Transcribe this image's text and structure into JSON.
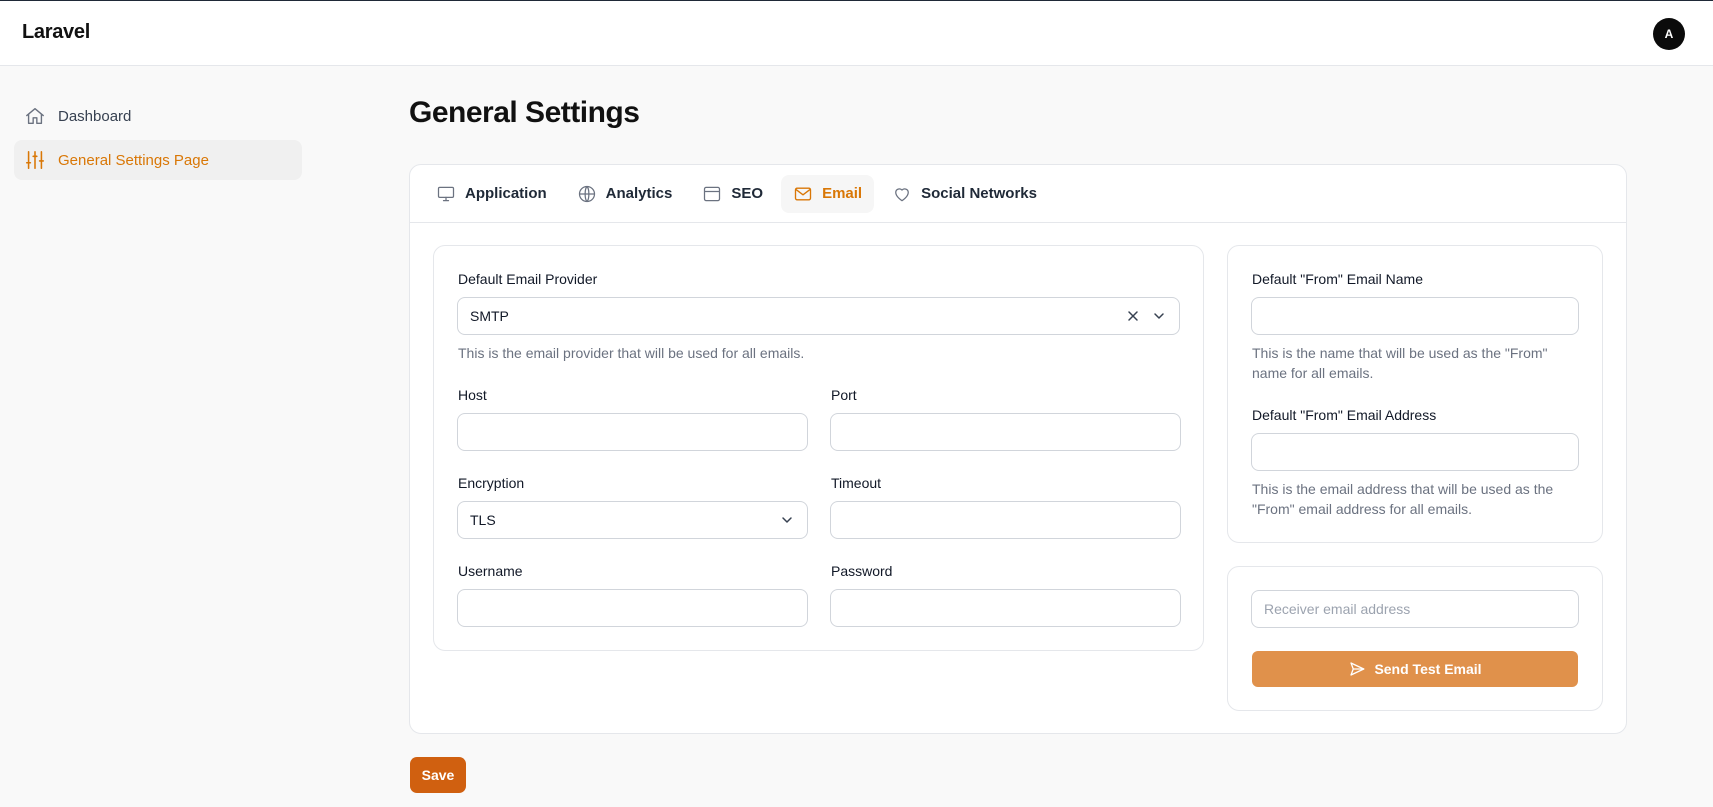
{
  "app": {
    "brand": "Laravel",
    "avatar_initial": "A"
  },
  "sidebar": {
    "items": [
      {
        "label": "Dashboard",
        "icon": "home-icon",
        "active": false
      },
      {
        "label": "General Settings Page",
        "icon": "sliders-icon",
        "active": true
      }
    ]
  },
  "page": {
    "title": "General Settings"
  },
  "tabs": [
    {
      "label": "Application",
      "icon": "computer-icon",
      "active": false
    },
    {
      "label": "Analytics",
      "icon": "globe-icon",
      "active": false
    },
    {
      "label": "SEO",
      "icon": "window-icon",
      "active": false
    },
    {
      "label": "Email",
      "icon": "envelope-icon",
      "active": true
    },
    {
      "label": "Social Networks",
      "icon": "heart-icon",
      "active": false
    }
  ],
  "email_form": {
    "provider": {
      "label": "Default Email Provider",
      "value": "SMTP",
      "hint": "This is the email provider that will be used for all emails."
    },
    "host": {
      "label": "Host",
      "value": ""
    },
    "port": {
      "label": "Port",
      "value": ""
    },
    "encryption": {
      "label": "Encryption",
      "value": "TLS"
    },
    "timeout": {
      "label": "Timeout",
      "value": ""
    },
    "username": {
      "label": "Username",
      "value": ""
    },
    "password": {
      "label": "Password",
      "value": ""
    }
  },
  "from_settings": {
    "name": {
      "label": "Default \"From\" Email Name",
      "value": "",
      "hint": "This is the name that will be used as the \"From\" name for all emails."
    },
    "address": {
      "label": "Default \"From\" Email Address",
      "value": "",
      "hint": "This is the email address that will be used as the \"From\" email address for all emails."
    }
  },
  "test_email": {
    "placeholder": "Receiver email address",
    "button_label": "Send Test Email"
  },
  "actions": {
    "save_label": "Save"
  },
  "colors": {
    "accent": "#d97706",
    "save_button": "#d06010",
    "send_button": "#e0914b",
    "background": "#f9f9f9"
  }
}
